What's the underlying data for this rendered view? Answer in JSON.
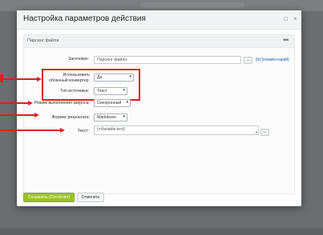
{
  "dialog": {
    "title": "Настройка параметров действия",
    "max_icon": "□",
    "close_icon": "×"
  },
  "panel": {
    "title": "Парсинг файла",
    "menu_icon": "•••"
  },
  "form": {
    "heading_label": "Заголовок:",
    "heading_value": "Парсинг файла",
    "heading_btn": "...",
    "link_fx": "[fx]",
    "link_comment": "[комментарий]",
    "cloud_label": "Использовать облачный конвертер:",
    "cloud_value": "Да",
    "source_label": "Тип источника:",
    "source_value": "Текст",
    "mode_label": "Режим выполнения запроса:",
    "mode_value": "Синхронный",
    "format_label": "Формат результата:",
    "format_value": "Markdown",
    "text_label": "Текст:",
    "text_value": "{=Variable:text}",
    "text_btn": "..."
  },
  "footer": {
    "save_label": "Сохранить (Ctrl+Enter)",
    "cancel_label": "Отменить"
  },
  "annotations": {
    "color": "#d9221c"
  }
}
